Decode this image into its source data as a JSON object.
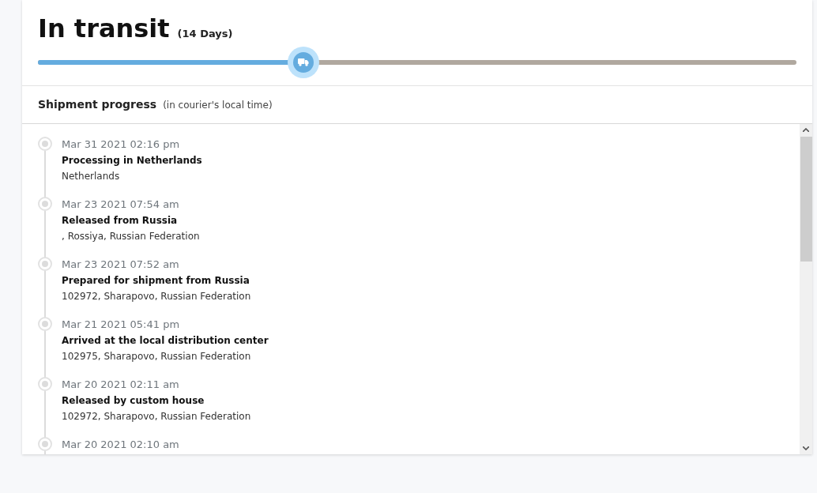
{
  "status": {
    "title": "In transit",
    "duration": "(14 Days)",
    "level": 0.35
  },
  "progress_header": {
    "title": "Shipment progress",
    "note": "(in courier's local time)"
  },
  "events": [
    {
      "date": "Mar 31 2021 02:16 pm",
      "title": "Processing in Netherlands",
      "location": "Netherlands"
    },
    {
      "date": "Mar 23 2021 07:54 am",
      "title": "Released from Russia",
      "location": ", Rossiya, Russian Federation"
    },
    {
      "date": "Mar 23 2021 07:52 am",
      "title": "Prepared for shipment from Russia",
      "location": "102972, Sharapovo, Russian Federation"
    },
    {
      "date": "Mar 21 2021 05:41 pm",
      "title": "Arrived at the local distribution center",
      "location": "102975, Sharapovo, Russian Federation"
    },
    {
      "date": "Mar 20 2021 02:11 am",
      "title": "Released by custom house",
      "location": "102972, Sharapovo, Russian Federation"
    },
    {
      "date": "Mar 20 2021 02:10 am"
    }
  ]
}
